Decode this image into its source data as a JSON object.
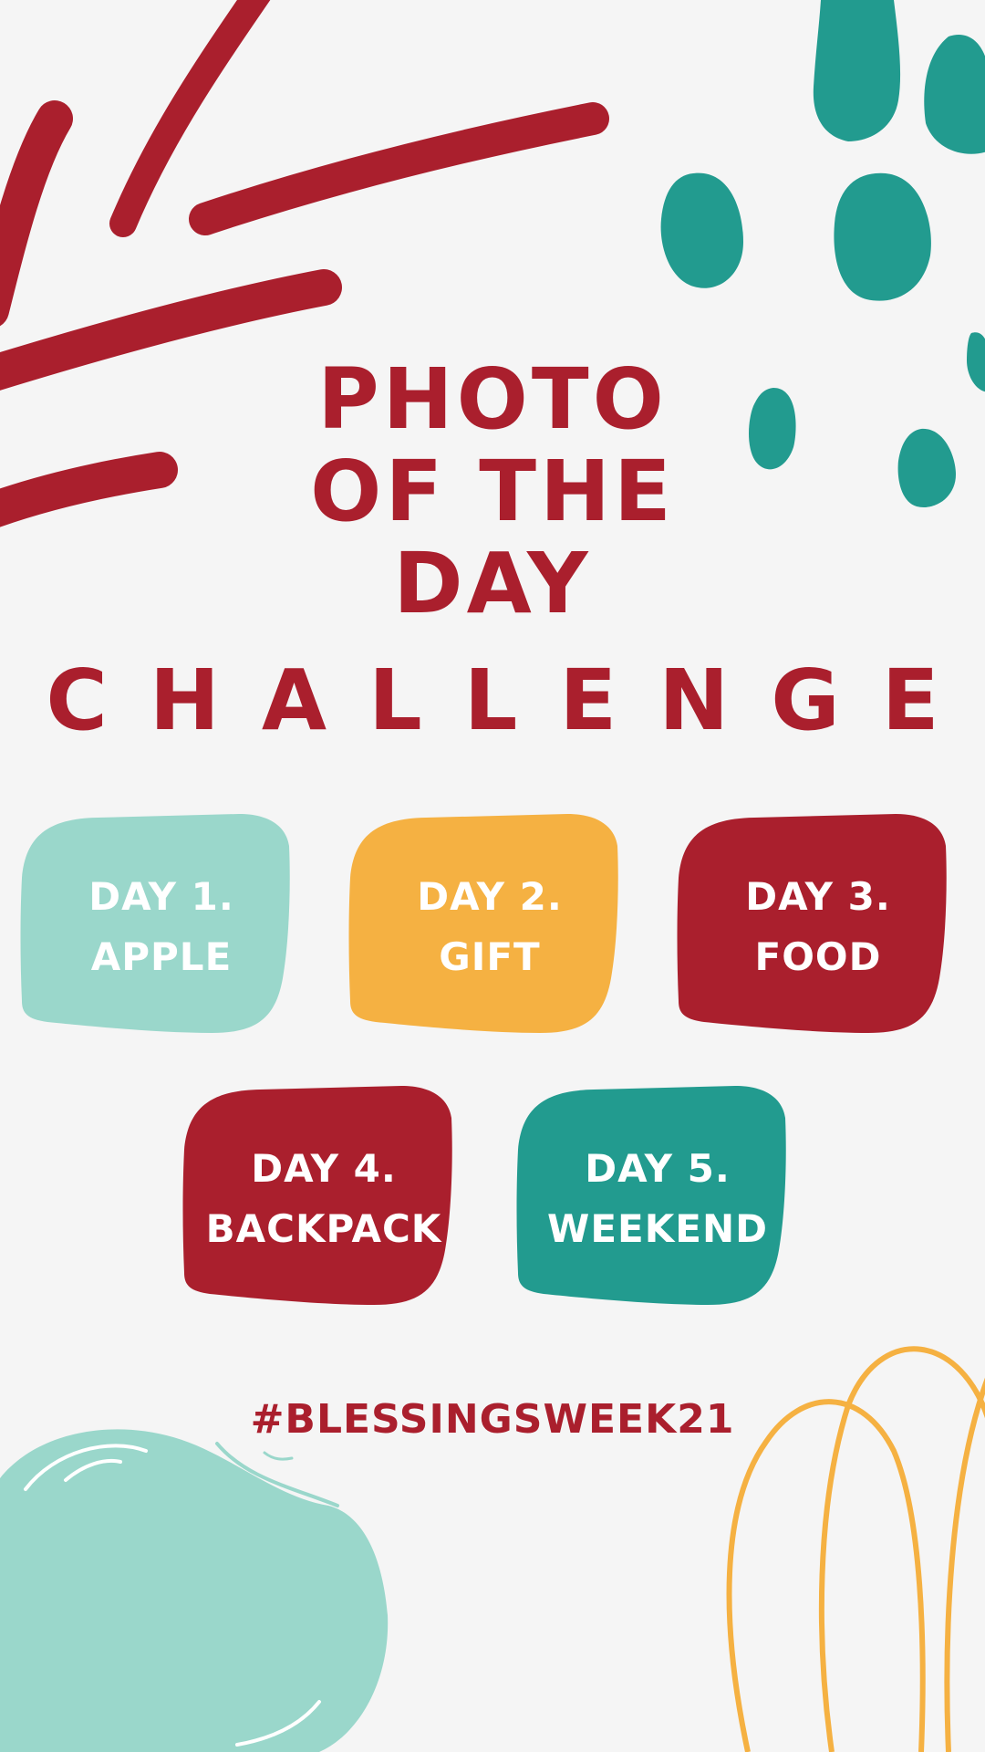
{
  "title": {
    "line1": "PHOTO",
    "line2": "OF THE",
    "line3": "DAY"
  },
  "subtitle": "CHALLENGE",
  "days": [
    {
      "label": "DAY 1.",
      "topic": "APPLE",
      "color": "#9ad7cb"
    },
    {
      "label": "DAY 2.",
      "topic": "GIFT",
      "color": "#f5b142"
    },
    {
      "label": "DAY 3.",
      "topic": "FOOD",
      "color": "#aa1f2d"
    },
    {
      "label": "DAY 4.",
      "topic": "BACKPACK",
      "color": "#aa1f2d"
    },
    {
      "label": "DAY 5.",
      "topic": "WEEKEND",
      "color": "#229b8f"
    }
  ],
  "hashtag": "#BLESSINGSWEEK21",
  "colors": {
    "red": "#aa1f2d",
    "teal": "#229b8f",
    "mint": "#9ad7cb",
    "yellow": "#f5b142",
    "background": "#f5f5f5"
  }
}
